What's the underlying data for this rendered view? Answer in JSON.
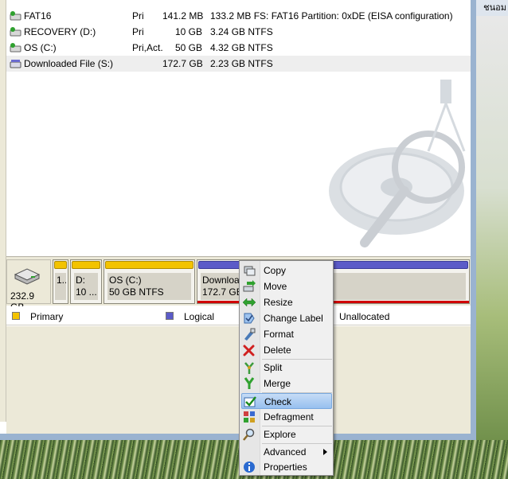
{
  "desktop": {
    "corner_text": "ชนอม"
  },
  "partitions": [
    {
      "name": "FAT16",
      "type": "Pri",
      "capacity": "141.2 MB",
      "free": "133.2 MB",
      "info": "FS: FAT16 Partition: 0xDE (EISA configuration)",
      "icon": "partition-icon-green"
    },
    {
      "name": "RECOVERY (D:)",
      "type": "Pri",
      "capacity": "10 GB",
      "free": "3.24 GB",
      "info": "NTFS",
      "icon": "partition-icon-green"
    },
    {
      "name": "OS (C:)",
      "type": "Pri,Act.",
      "capacity": "50 GB",
      "free": "4.32 GB",
      "info": "NTFS",
      "icon": "partition-icon-green"
    },
    {
      "name": "Downloaded File (S:)",
      "type": "",
      "capacity": "172.7 GB",
      "free": "2.23 GB",
      "info": "NTFS",
      "icon": "partition-icon-blue"
    }
  ],
  "diskmap": {
    "disk_size": "232.9 GB",
    "segments": [
      {
        "line1": "1..",
        "line2": "",
        "kind": "primary"
      },
      {
        "line1": "D:",
        "line2": "10 ...",
        "kind": "primary"
      },
      {
        "line1": "OS (C:)",
        "line2": "50 GB  NTFS",
        "kind": "primary"
      },
      {
        "line1": "Downloa",
        "line2": "172.7 GB",
        "kind": "logical"
      }
    ]
  },
  "legend": {
    "primary": "Primary",
    "logical": "Logical",
    "unallocated": "Unallocated",
    "colors": {
      "primary": "#f3c300",
      "logical": "#5b5bc8",
      "unallocated": "#c0c0c0"
    }
  },
  "context_menu": {
    "items": [
      {
        "label": "Copy",
        "icon": "copy-icon"
      },
      {
        "label": "Move",
        "icon": "move-icon"
      },
      {
        "label": "Resize",
        "icon": "resize-icon"
      },
      {
        "label": "Change Label",
        "icon": "change-label-icon"
      },
      {
        "label": "Format",
        "icon": "format-icon"
      },
      {
        "label": "Delete",
        "icon": "delete-icon"
      },
      {
        "label": "Split",
        "icon": "split-icon"
      },
      {
        "label": "Merge",
        "icon": "merge-icon"
      },
      {
        "label": "Check",
        "icon": "check-icon"
      },
      {
        "label": "Defragment",
        "icon": "defragment-icon"
      },
      {
        "label": "Explore",
        "icon": "explore-icon"
      },
      {
        "label": "Advanced",
        "icon": "",
        "submenu": true
      },
      {
        "label": "Properties",
        "icon": "properties-icon"
      }
    ],
    "highlighted": "Check"
  }
}
